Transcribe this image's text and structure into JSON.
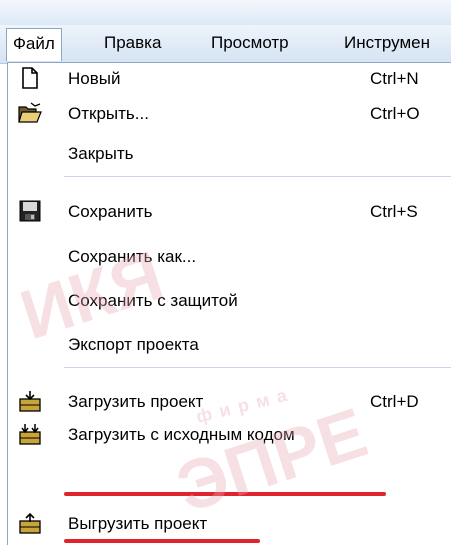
{
  "menubar": {
    "items": [
      "Файл",
      "Правка",
      "Просмотр",
      "Инструмен"
    ]
  },
  "menu": {
    "items": [
      {
        "label": "Новый",
        "shortcut": "Ctrl+N",
        "icon": "new-document-icon"
      },
      {
        "label": "Открыть...",
        "shortcut": "Ctrl+O",
        "icon": "open-folder-icon"
      },
      {
        "label": "Закрыть",
        "shortcut": "",
        "icon": ""
      },
      {
        "label": "Сохранить",
        "shortcut": "Ctrl+S",
        "icon": "save-disk-icon"
      },
      {
        "label": "Сохранить как...",
        "shortcut": "",
        "icon": ""
      },
      {
        "label": "Сохранить с защитой",
        "shortcut": "",
        "icon": ""
      },
      {
        "label": "Экспорт проекта",
        "shortcut": "",
        "icon": ""
      },
      {
        "label": "Загрузить проект",
        "shortcut": "Ctrl+D",
        "icon": "load-project-icon"
      },
      {
        "label": "Загрузить с исходным кодом",
        "shortcut": "",
        "icon": "load-source-icon"
      },
      {
        "label": "Выгрузить проект",
        "shortcut": "",
        "icon": "unload-project-icon"
      }
    ]
  },
  "watermark": {
    "line1": "ИКЯ",
    "line2": "фирма",
    "line3": "ЭПРЕ"
  },
  "colors": {
    "highlight_underline": "#e0242d"
  }
}
